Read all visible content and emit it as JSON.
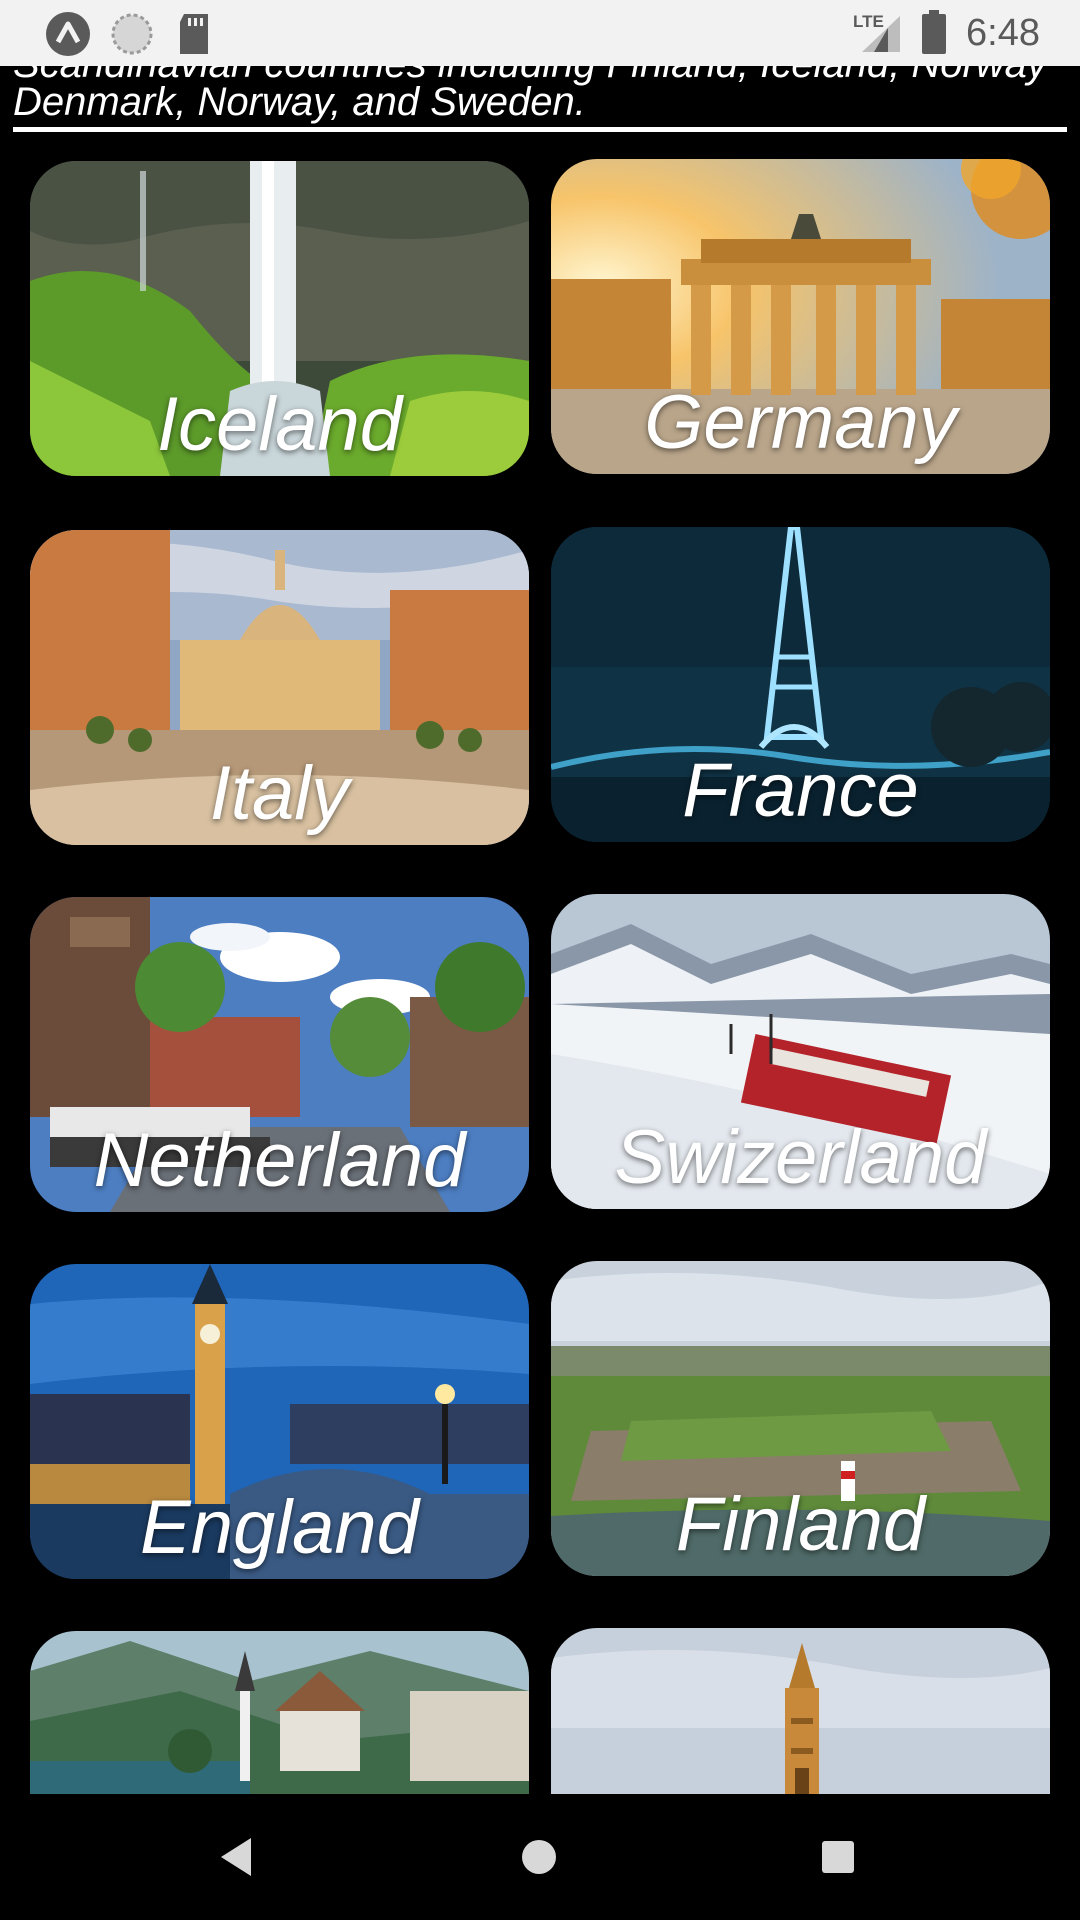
{
  "status_bar": {
    "time": "6:48",
    "network_label": "LTE",
    "left_icons": [
      "app-logo-icon",
      "sync-circle-icon",
      "sd-card-icon"
    ],
    "right_icons": [
      "signal-icon",
      "battery-icon"
    ]
  },
  "header": {
    "partial_line": "Scandinavian countries including Finland, Iceland, Norway",
    "description": "Denmark, Norway, and Sweden."
  },
  "countries": [
    {
      "name": "Iceland"
    },
    {
      "name": "Germany"
    },
    {
      "name": "Italy"
    },
    {
      "name": "France"
    },
    {
      "name": "Netherland"
    },
    {
      "name": "Swizerland"
    },
    {
      "name": "England"
    },
    {
      "name": "Finland"
    },
    {
      "name": ""
    },
    {
      "name": ""
    }
  ],
  "nav_bar": {
    "buttons": [
      "back-icon",
      "home-icon",
      "recents-icon"
    ]
  },
  "colors": {
    "background": "#000000",
    "status_bar": "#f2f2f2",
    "text": "#ffffff"
  }
}
